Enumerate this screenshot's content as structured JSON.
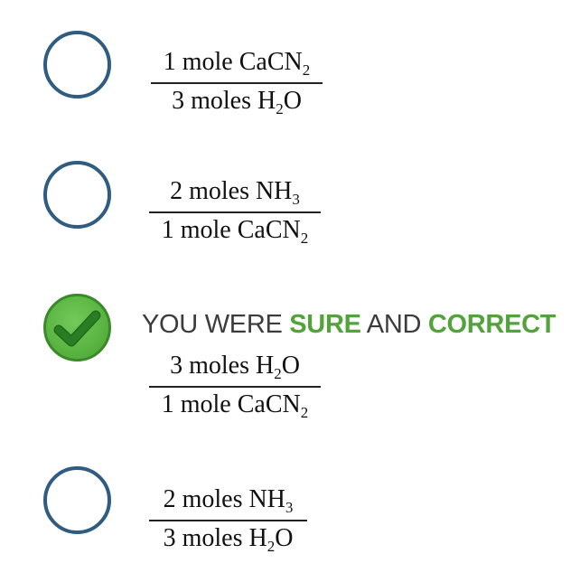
{
  "options": [
    {
      "numerator": {
        "amount": "1 mole CaCN",
        "sub": "2",
        "tail": ""
      },
      "denominator": {
        "amount": "3 moles H",
        "sub": "2",
        "tail": "O"
      },
      "state": "unselected"
    },
    {
      "numerator": {
        "amount": "2 moles NH",
        "sub": "3",
        "tail": ""
      },
      "denominator": {
        "amount": "1 mole CaCN",
        "sub": "2",
        "tail": ""
      },
      "state": "unselected"
    },
    {
      "numerator": {
        "amount": "3 moles H",
        "sub": "2",
        "tail": "O"
      },
      "denominator": {
        "amount": "1 mole CaCN",
        "sub": "2",
        "tail": ""
      },
      "state": "selected-correct"
    },
    {
      "numerator": {
        "amount": "2 moles NH",
        "sub": "3",
        "tail": ""
      },
      "denominator": {
        "amount": "3 moles H",
        "sub": "2",
        "tail": "O"
      },
      "state": "unselected"
    }
  ],
  "feedback": {
    "prefix": "YOU WERE ",
    "sure": "SURE",
    "middle": " AND ",
    "correct": "CORRECT"
  },
  "colors": {
    "radio_border": "#2f5c80",
    "correct_fill": "#5cb643",
    "feedback_accent": "#52a33b",
    "feedback_text": "#3c3c3c"
  },
  "icons": {
    "radio": "radio-circle-icon",
    "correct": "checkmark-icon"
  }
}
